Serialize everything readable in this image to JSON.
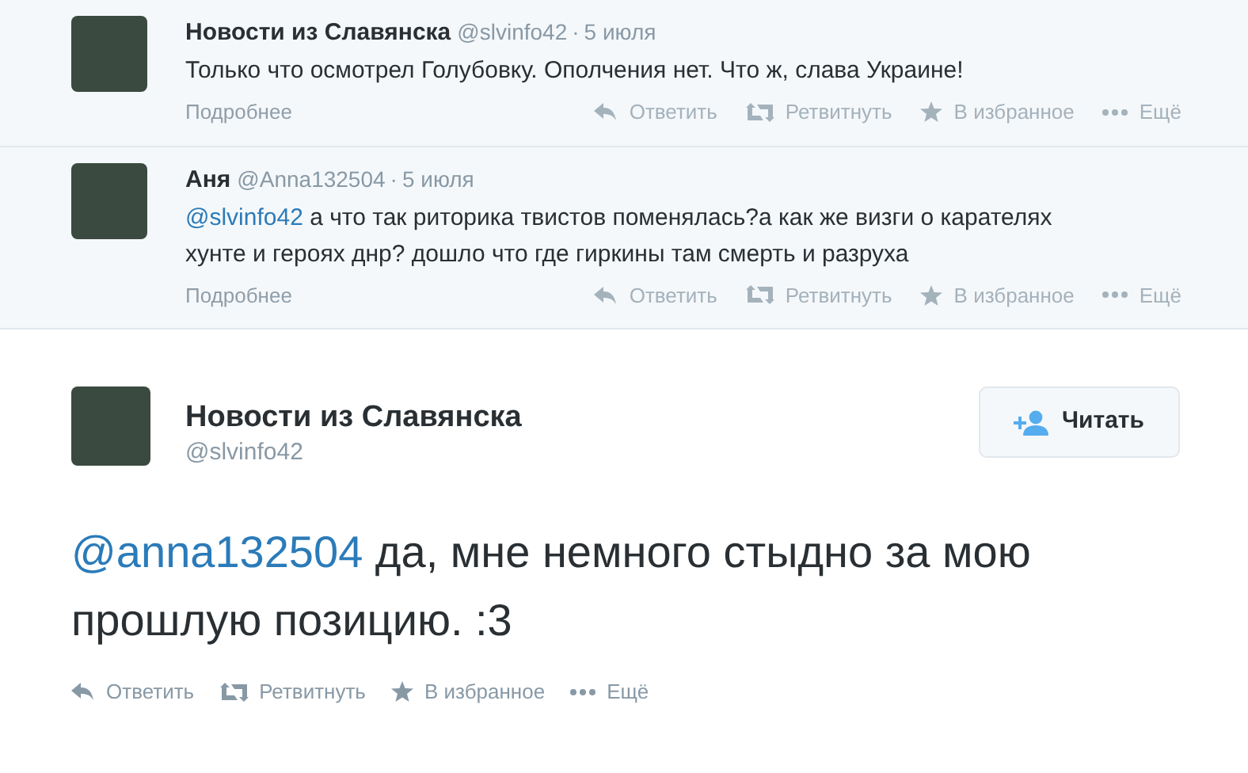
{
  "replies": [
    {
      "name": "Новости из Славянска",
      "handle": "@slvinfo42",
      "separator": "·",
      "time": "5 июля",
      "text": "Только что осмотрел Голубовку. Ополчения нет. Что ж, слава Украине!",
      "details": "Подробнее",
      "actions": [
        "Ответить",
        "Ретвитнуть",
        "В избранное",
        "Ещё"
      ]
    },
    {
      "name": "Аня",
      "handle": "@Anna132504",
      "separator": "·",
      "time": "5 июля",
      "mention": "@slvinfo42",
      "text": " а что так риторика твистов поменялась?а как же визги о карателях хунте и героях днр? дошло что где гиркины там смерть и разруха",
      "details": "Подробнее",
      "actions": [
        "Ответить",
        "Ретвитнуть",
        "В избранное",
        "Ещё"
      ]
    }
  ],
  "main_tweet": {
    "name": "Новости из Славянска",
    "handle": "@slvinfo42",
    "follow_button": "Читать",
    "mention": "@anna132504",
    "text": " да, мне немного стыдно за мою прошлую позицию. :3",
    "actions": [
      "Ответить",
      "Ретвитнуть",
      "В избранное",
      "Ещё"
    ]
  }
}
